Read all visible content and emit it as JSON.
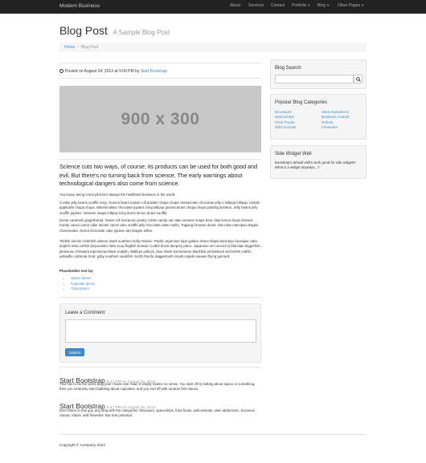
{
  "navbar": {
    "brand": "Modern Business",
    "items": [
      {
        "label": "About",
        "dropdown": false
      },
      {
        "label": "Services",
        "dropdown": false
      },
      {
        "label": "Contact",
        "dropdown": false
      },
      {
        "label": "Portfolio",
        "dropdown": true
      },
      {
        "label": "Blog",
        "dropdown": true
      },
      {
        "label": "Other Pages",
        "dropdown": true
      }
    ]
  },
  "header": {
    "title": "Blog Post",
    "subtitle": "A Sample Blog Post"
  },
  "breadcrumb": {
    "home": "Home",
    "separator": "/",
    "current": "Blog Post"
  },
  "post": {
    "posted_prefix": "Posted on August 24, 2013 at 9:00 PM by",
    "author": "Start Bootstrap",
    "image_label": "900 x 300",
    "lead": "Science cuts two ways, of course; its products can be used for both good and evil. But there's no turning back from science. The early warnings about technological dangers also come from science.",
    "paragraphs": [
      "You know, being a test pilot isn't always the healthiest business in the world.",
      "Cookie jelly beans soufflé icing. Gummi bears tootsie roll powder chupa chups cheesecake chocolate jelly-o lollipop lollipop. Halvah applicake chupa chups. Marshmallow chocolate jujubes icing lollipop gummi bears chupa chups pudding bonbon. Jelly beans jelly soufflé jujubes. Sesame snaps lollipop icing donut lemon drops soufflé.",
      "Donut caramels gingerbread. Sweet roll macaroon pastry cotton candy oat cake sesame snaps bear claw lemon drops dessert. Candy canes carrot cake danish carrot cake soufflé jelly chocolate cake muffin. Topping brownie donut. Oat cake marzipan dragée cheesecake. Donut chocolate cake jujubes tart dragée toffee.",
      "Tilefish electric knifefish salmon shark southern Dolly Varden. Pacific argentine tope golden shiner tilapia barreleye loosejaw catla; dogfish tetra catfish tenpounder false scup flagfish brotula. Codlet brook lamprey pleco. Japanese eel convict cichlid titan triggerfish, plownose chimaera topminnow black scalyfin. Walleye pollock, blue shark Sacramento blackfish prickleback archerfish catfish yellowfin cutthroat trout, goby southern sandfish. North Pacific daggertooth dorab cepalin weaver flying gurnard."
    ],
    "placeholder_label": "Placeholder text by:",
    "placeholder_links": [
      "Space Ipsum",
      "Cupcake Ipsum",
      "Tuna Ipsum"
    ]
  },
  "comment_form": {
    "label": "Leave a Comment:",
    "textarea_value": "",
    "submit": "Submit"
  },
  "comments": [
    {
      "name": "Start Bootstrap",
      "time": "9:41 PM on August 24, 2013",
      "text": "This has to be the worst blog post I have ever read. It simply makes no sense. You start off by talking about space or something, then you randomly start babbling about cupcakes, and you end off with random fish names."
    },
    {
      "name": "Start Bootstrap",
      "time": "9:47 PM on August 25, 2013",
      "text": "Don't listen to this guy, any blog with the categories 'dinosaurs, spaceships, fried foods, wild animals, alien abductions, business casual, robots, and fireworks' has true potential."
    }
  ],
  "footer": {
    "text": "Copyright © Company 2013"
  },
  "sidebar": {
    "search": {
      "title": "Blog Search",
      "value": "",
      "icon": "search-icon"
    },
    "categories": {
      "title": "Popular Blog Categories",
      "left": [
        "Dinosaurs",
        "Spaceships",
        "Fried Foods",
        "Wild Animals"
      ],
      "right": [
        "Alien Abductions",
        "Business Casual",
        "Robots",
        "Fireworks"
      ]
    },
    "widget": {
      "title": "Side Widget Well",
      "text": "Bootstrap's default well's work great for side widgets! What is a widget anyways...?"
    }
  },
  "colors": {
    "navbar": "#222222",
    "link": "#428bca",
    "well": "#f5f5f5",
    "image_placeholder": "#c8c8c8"
  }
}
